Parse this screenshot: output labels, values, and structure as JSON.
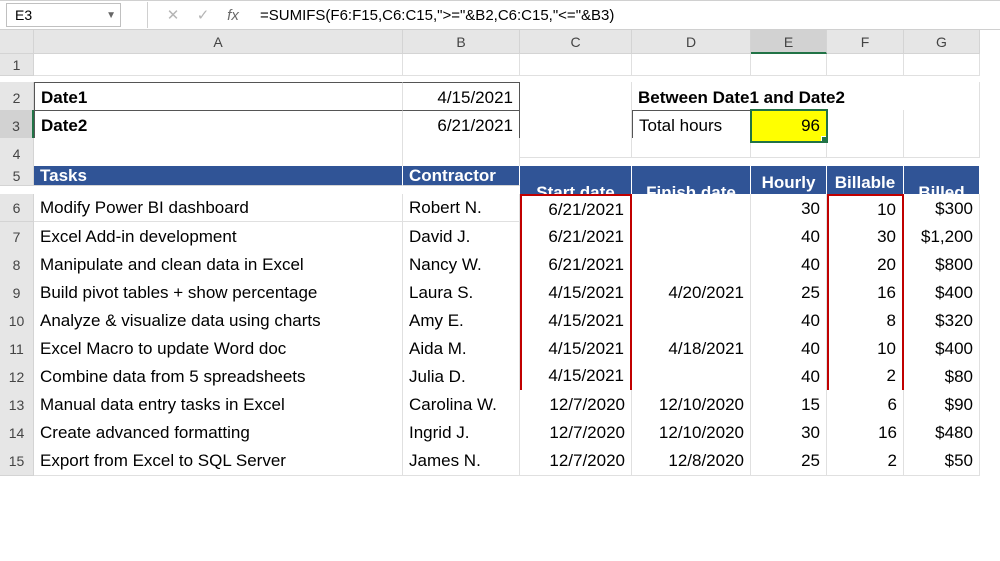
{
  "namebox": "E3",
  "formula": "=SUMIFS(F6:F15,C6:C15,\">=\"&B2,C6:C15,\"<=\"&B3)",
  "fbar": {
    "cancel": "✕",
    "enter": "✓",
    "fx": "fx"
  },
  "cols": [
    "A",
    "B",
    "C",
    "D",
    "E",
    "F",
    "G"
  ],
  "sel_col_index": 4,
  "labels": {
    "date1": "Date1",
    "date2": "Date2",
    "date1_val": "4/15/2021",
    "date2_val": "6/21/2021",
    "between": "Between Date1 and Date2",
    "total_hours": "Total hours",
    "total_hours_val": "96"
  },
  "headers": {
    "tasks": "Tasks",
    "contractor": "Contractor",
    "start": "Start date",
    "finish": "Finish date",
    "rate": "Hourly rate",
    "bill_hours": "Billable hours",
    "billed": "Billed"
  },
  "rows": [
    {
      "task": "Modify Power BI dashboard",
      "contractor": "Robert N.",
      "start": "6/21/2021",
      "finish": "",
      "rate": "30",
      "hours": "10",
      "billed": "$300"
    },
    {
      "task": "Excel Add-in development",
      "contractor": "David J.",
      "start": "6/21/2021",
      "finish": "",
      "rate": "40",
      "hours": "30",
      "billed": "$1,200"
    },
    {
      "task": "Manipulate and clean data in Excel",
      "contractor": "Nancy W.",
      "start": "6/21/2021",
      "finish": "",
      "rate": "40",
      "hours": "20",
      "billed": "$800"
    },
    {
      "task": "Build pivot tables + show percentage",
      "contractor": "Laura S.",
      "start": "4/15/2021",
      "finish": "4/20/2021",
      "rate": "25",
      "hours": "16",
      "billed": "$400"
    },
    {
      "task": "Analyze & visualize data using charts",
      "contractor": "Amy E.",
      "start": "4/15/2021",
      "finish": "",
      "rate": "40",
      "hours": "8",
      "billed": "$320"
    },
    {
      "task": "Excel Macro to update Word doc",
      "contractor": "Aida M.",
      "start": "4/15/2021",
      "finish": "4/18/2021",
      "rate": "40",
      "hours": "10",
      "billed": "$400"
    },
    {
      "task": "Combine data from 5 spreadsheets",
      "contractor": "Julia D.",
      "start": "4/15/2021",
      "finish": "",
      "rate": "40",
      "hours": "2",
      "billed": "$80"
    },
    {
      "task": "Manual data entry tasks in Excel",
      "contractor": "Carolina W.",
      "start": "12/7/2020",
      "finish": "12/10/2020",
      "rate": "15",
      "hours": "6",
      "billed": "$90"
    },
    {
      "task": "Create advanced formatting",
      "contractor": "Ingrid J.",
      "start": "12/7/2020",
      "finish": "12/10/2020",
      "rate": "30",
      "hours": "16",
      "billed": "$480"
    },
    {
      "task": "Export from Excel to SQL Server",
      "contractor": "James N.",
      "start": "12/7/2020",
      "finish": "12/8/2020",
      "rate": "25",
      "hours": "2",
      "billed": "$50"
    }
  ],
  "red_c_rows": [
    0,
    1,
    2,
    3,
    4,
    5,
    6
  ],
  "red_f_rows": [
    0,
    1,
    2,
    3,
    4,
    5,
    6
  ],
  "sel_row": 3
}
